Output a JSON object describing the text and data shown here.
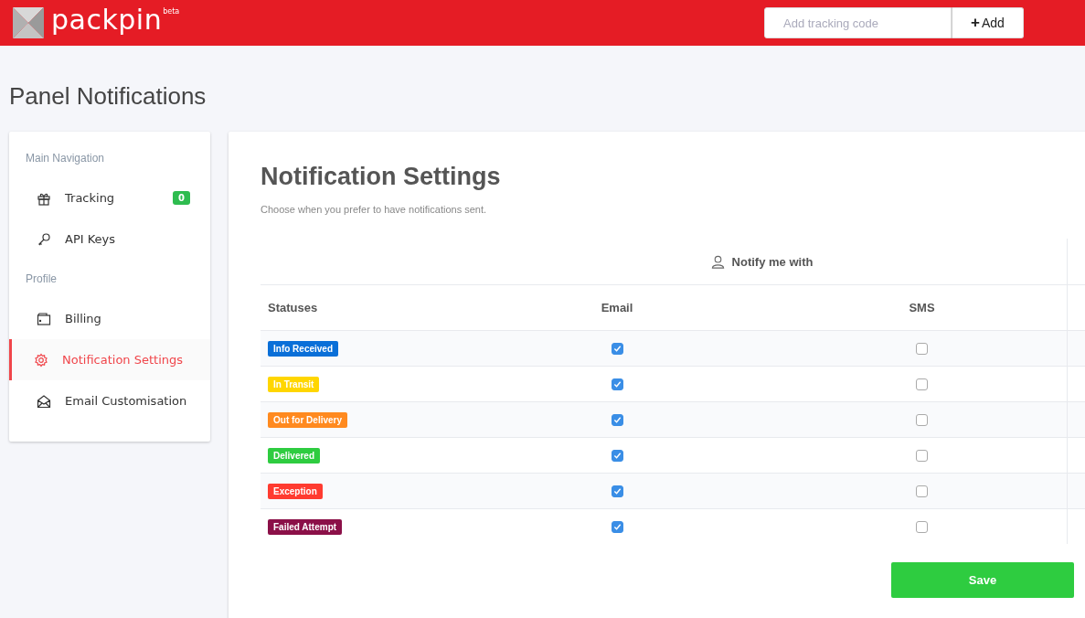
{
  "header": {
    "logo": "packpin",
    "logo_badge": "beta",
    "search": {
      "placeholder": "Add tracking code"
    },
    "add_button": {
      "icon": "+",
      "label": "Add"
    }
  },
  "page_title": "Panel Notifications",
  "sidebar": {
    "sections": [
      {
        "title": "Main Navigation",
        "items": [
          {
            "kind": "gift",
            "label": "Tracking",
            "badge": "0",
            "selected": false
          },
          {
            "kind": "key",
            "label": "API Keys",
            "selected": false
          }
        ]
      },
      {
        "title": "Profile",
        "items": [
          {
            "kind": "wallet",
            "label": "Billing",
            "selected": false
          },
          {
            "kind": "gear",
            "label": "Notification Settings",
            "selected": true
          },
          {
            "kind": "mail",
            "label": "Email Customisation",
            "selected": false
          }
        ]
      }
    ]
  },
  "panel": {
    "title": "Notification Settings",
    "subtitle": "Choose when you prefer to have notifications sent.",
    "group_header": "Notify me with",
    "columns": [
      "Statuses",
      "Email",
      "SMS"
    ],
    "rows": [
      {
        "status": "Info Received",
        "color": "#0a6fd8",
        "email": true,
        "sms": false
      },
      {
        "status": "In Transit",
        "color": "#ffd600",
        "email": true,
        "sms": false
      },
      {
        "status": "Out for Delivery",
        "color": "#ff8a1f",
        "email": true,
        "sms": false
      },
      {
        "status": "Delivered",
        "color": "#2ecc40",
        "email": true,
        "sms": false
      },
      {
        "status": "Exception",
        "color": "#ff3b30",
        "email": true,
        "sms": false
      },
      {
        "status": "Failed Attempt",
        "color": "#8b1048",
        "email": true,
        "sms": false
      }
    ],
    "save_button": "Save"
  }
}
